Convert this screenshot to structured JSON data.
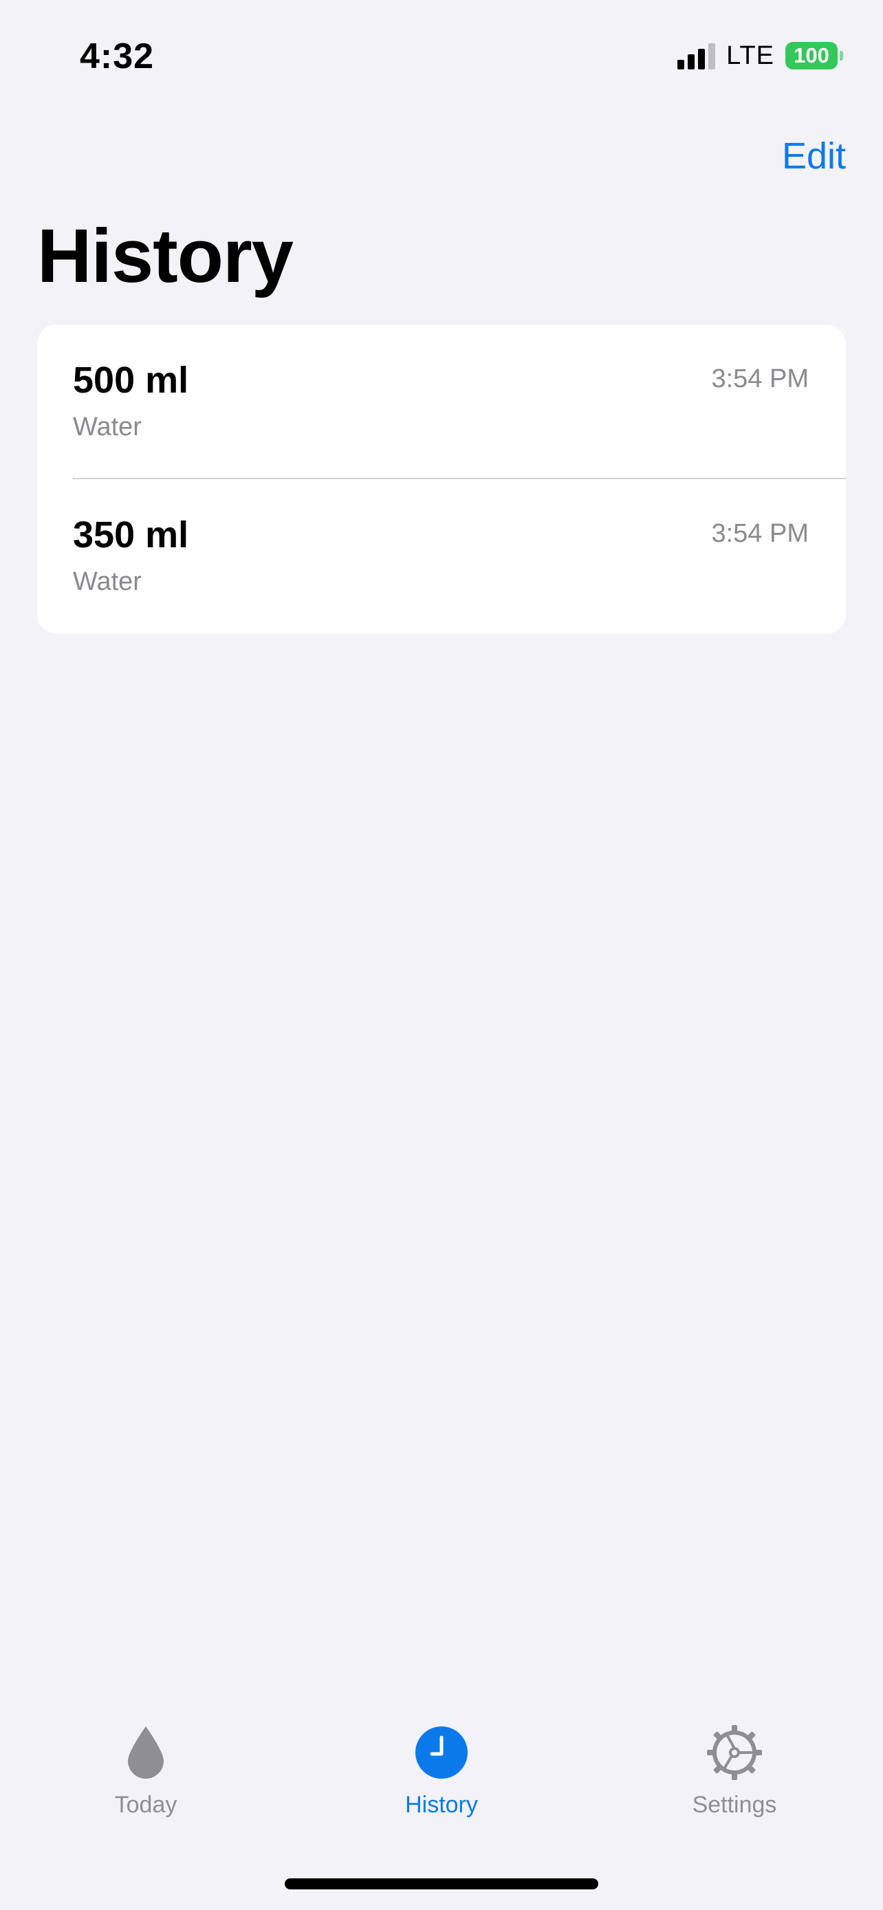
{
  "status_bar": {
    "time": "4:32",
    "network": "LTE",
    "battery": "100",
    "signal_bars_filled": 3,
    "signal_bars_total": 4
  },
  "nav": {
    "edit_label": "Edit",
    "title": "History"
  },
  "entries": [
    {
      "amount": "500 ml",
      "kind": "Water",
      "time": "3:54 PM"
    },
    {
      "amount": "350 ml",
      "kind": "Water",
      "time": "3:54 PM"
    }
  ],
  "tabs": [
    {
      "label": "Today",
      "icon": "water-drop-icon",
      "active": false
    },
    {
      "label": "History",
      "icon": "clock-icon",
      "active": true
    },
    {
      "label": "Settings",
      "icon": "gear-icon",
      "active": false
    }
  ],
  "colors": {
    "accent": "#0a7aea",
    "background": "#f2f2f7",
    "battery": "#34c759",
    "inactive": "#8e8e93"
  }
}
